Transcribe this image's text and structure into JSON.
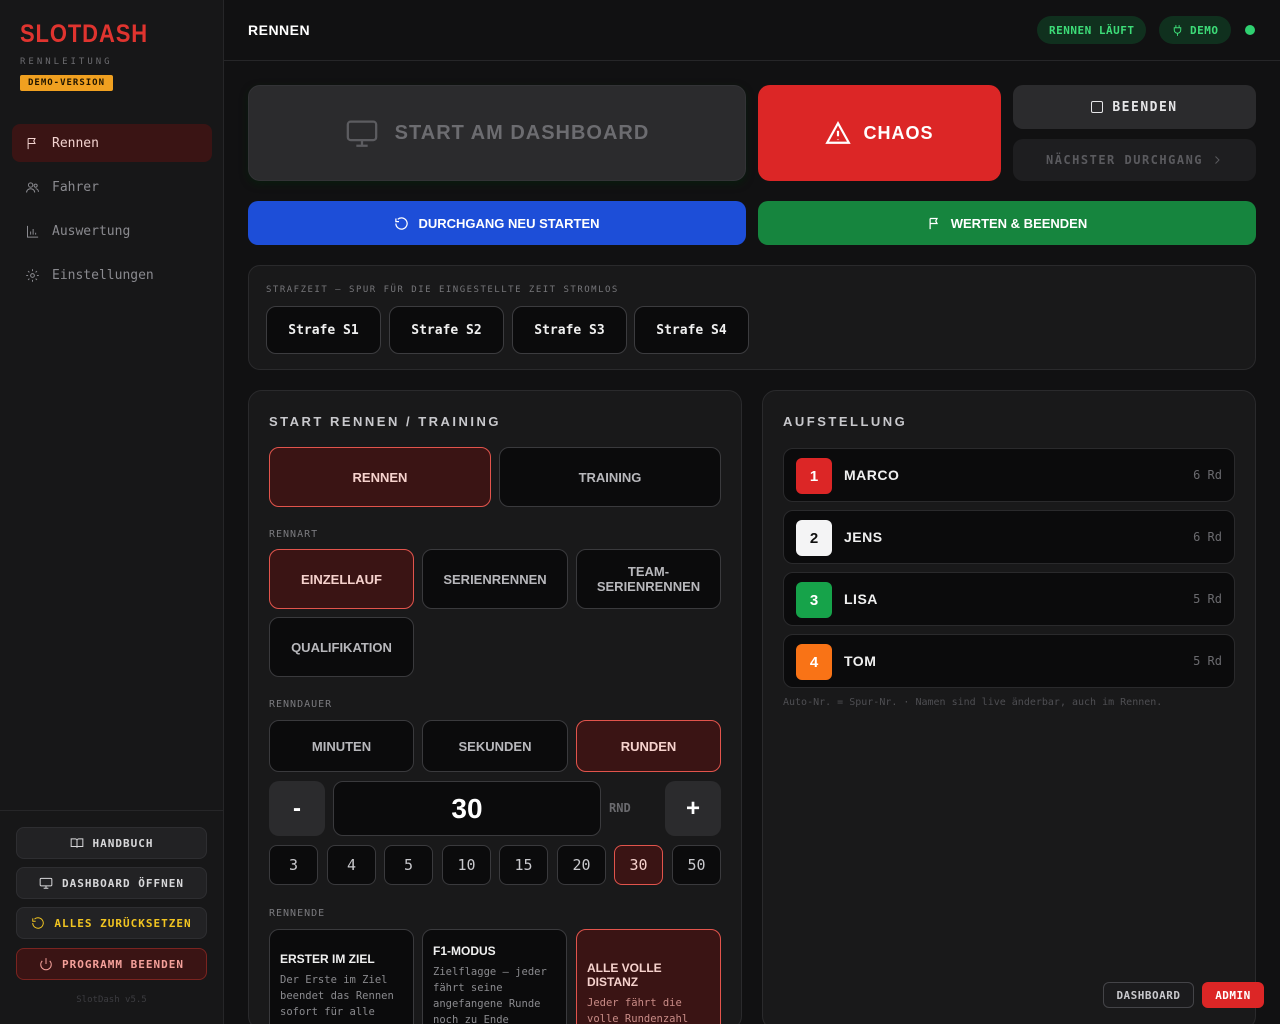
{
  "brand": {
    "title": "SLOTDASH",
    "subtitle": "RENNLEITUNG",
    "badge": "DEMO-VERSION"
  },
  "nav": [
    {
      "label": "Rennen",
      "icon": "flag-icon",
      "active": true
    },
    {
      "label": "Fahrer",
      "icon": "users-icon",
      "active": false
    },
    {
      "label": "Auswertung",
      "icon": "bar-chart-icon",
      "active": false
    },
    {
      "label": "Einstellungen",
      "icon": "gear-icon",
      "active": false
    }
  ],
  "sidebar_actions": {
    "manual": "HANDBUCH",
    "open_dashboard": "DASHBOARD ÖFFNEN",
    "reset_all": "ALLES ZURÜCKSETZEN",
    "quit": "PROGRAMM BEENDEN"
  },
  "version": "SlotDash v5.5",
  "header": {
    "title": "RENNEN",
    "status_pill": "RENNEN LÄUFT",
    "demo_pill": "DEMO"
  },
  "controls": {
    "start": "START AM DASHBOARD",
    "chaos": "CHAOS",
    "end": "BEENDEN",
    "next_heat": "NÄCHSTER DURCHGANG",
    "restart_heat": "DURCHGANG NEU STARTEN",
    "score_end": "WERTEN & BEENDEN"
  },
  "penalty": {
    "label": "STRAFZEIT — SPUR FÜR DIE EINGESTELLTE ZEIT STROMLOS",
    "buttons": [
      "Strafe S1",
      "Strafe S2",
      "Strafe S3",
      "Strafe S4"
    ]
  },
  "start_panel": {
    "title": "START RENNEN / TRAINING",
    "modes": [
      {
        "label": "RENNEN",
        "selected": true
      },
      {
        "label": "TRAINING",
        "selected": false
      }
    ],
    "race_type_label": "RENNART",
    "race_types": [
      {
        "label": "EINZELLAUF",
        "selected": true
      },
      {
        "label": "SERIENRENNEN",
        "selected": false
      },
      {
        "label": "TEAM-SERIENRENNEN",
        "selected": false
      },
      {
        "label": "QUALIFIKATION",
        "selected": false
      }
    ],
    "duration_label": "RENNDAUER",
    "duration_units": [
      {
        "label": "MINUTEN",
        "selected": false
      },
      {
        "label": "SEKUNDEN",
        "selected": false
      },
      {
        "label": "RUNDEN",
        "selected": true
      }
    ],
    "stepper": {
      "minus": "-",
      "value": "30",
      "unit": "RND",
      "plus": "+"
    },
    "quick_values": [
      "3",
      "4",
      "5",
      "10",
      "15",
      "20",
      "30",
      "50"
    ],
    "quick_selected": "30",
    "race_end_label": "RENNENDE",
    "race_end_options": [
      {
        "title": "ERSTER IM ZIEL",
        "desc": "Der Erste im Ziel beendet das Rennen sofort für alle",
        "selected": false
      },
      {
        "title": "F1-MODUS",
        "desc": "Zielflagge — jeder fährt seine angefangene Runde noch zu Ende",
        "selected": false
      },
      {
        "title": "ALLE VOLLE DISTANZ",
        "desc": "Jeder fährt die volle Rundenzahl",
        "selected": true
      }
    ]
  },
  "lineup": {
    "title": "AUFSTELLUNG",
    "drivers": [
      {
        "num": "1",
        "name": "MARCO",
        "laps": "6 Rd",
        "color": "#dc2626",
        "text_color": "#ffffff"
      },
      {
        "num": "2",
        "name": "JENS",
        "laps": "6 Rd",
        "color": "#f4f4f5",
        "text_color": "#111111"
      },
      {
        "num": "3",
        "name": "LISA",
        "laps": "5 Rd",
        "color": "#16a34a",
        "text_color": "#ffffff"
      },
      {
        "num": "4",
        "name": "TOM",
        "laps": "5 Rd",
        "color": "#f97316",
        "text_color": "#ffffff"
      }
    ],
    "note": "Auto-Nr. = Spur-Nr. · Namen sind live änderbar, auch im Rennen."
  },
  "view_toggle": {
    "dashboard": "DASHBOARD",
    "admin": "ADMIN"
  },
  "colors": {
    "accent_red": "#dc2626",
    "blue": "#1d4ed8",
    "green": "#16853e",
    "demo_yellow": "#f0a020"
  }
}
